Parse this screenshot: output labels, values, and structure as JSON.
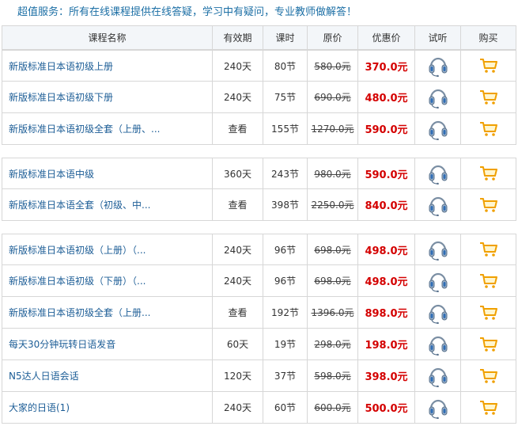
{
  "banner": "超值服务：所有在线课程提供在线答疑，学习中有疑问，专业教师做解答！",
  "columns": [
    "课程名称",
    "有效期",
    "课时",
    "原价",
    "优惠价",
    "试听",
    "购买"
  ],
  "colors": {
    "title": "#1c5d96",
    "discount": "#d40000",
    "border": "#d7d7d7",
    "cart": "#f5a300",
    "headphone": "#5a7fa8"
  },
  "groups": [
    {
      "rows": [
        {
          "title": "新版标准日本语初级上册",
          "duration": "240天",
          "hours": "80节",
          "original": "580.0元",
          "price": "370.0元"
        },
        {
          "title": "新版标准日本语初级下册",
          "duration": "240天",
          "hours": "75节",
          "original": "690.0元",
          "price": "480.0元"
        },
        {
          "title": "新版标准日本语初级全套（上册、...",
          "duration": "查看",
          "hours": "155节",
          "original": "1270.0元",
          "price": "590.0元"
        }
      ]
    },
    {
      "rows": [
        {
          "title": "新版标准日本语中级",
          "duration": "360天",
          "hours": "243节",
          "original": "980.0元",
          "price": "590.0元"
        },
        {
          "title": "新版标准日本语全套（初级、中...",
          "duration": "查看",
          "hours": "398节",
          "original": "2250.0元",
          "price": "840.0元"
        }
      ]
    },
    {
      "rows": [
        {
          "title": "新版标准日本语初级（上册）（...",
          "duration": "240天",
          "hours": "96节",
          "original": "698.0元",
          "price": "498.0元"
        },
        {
          "title": "新版标准日本语初级（下册）（...",
          "duration": "240天",
          "hours": "96节",
          "original": "698.0元",
          "price": "498.0元"
        },
        {
          "title": "新版标准日本语初级全套（上册...",
          "duration": "查看",
          "hours": "192节",
          "original": "1396.0元",
          "price": "898.0元"
        },
        {
          "title": "每天30分钟玩转日语发音",
          "duration": "60天",
          "hours": "19节",
          "original": "298.0元",
          "price": "198.0元"
        },
        {
          "title": "N5达人日语会话",
          "duration": "120天",
          "hours": "37节",
          "original": "598.0元",
          "price": "398.0元"
        },
        {
          "title": "大家的日语(1)",
          "duration": "240天",
          "hours": "60节",
          "original": "600.0元",
          "price": "500.0元"
        }
      ]
    }
  ]
}
